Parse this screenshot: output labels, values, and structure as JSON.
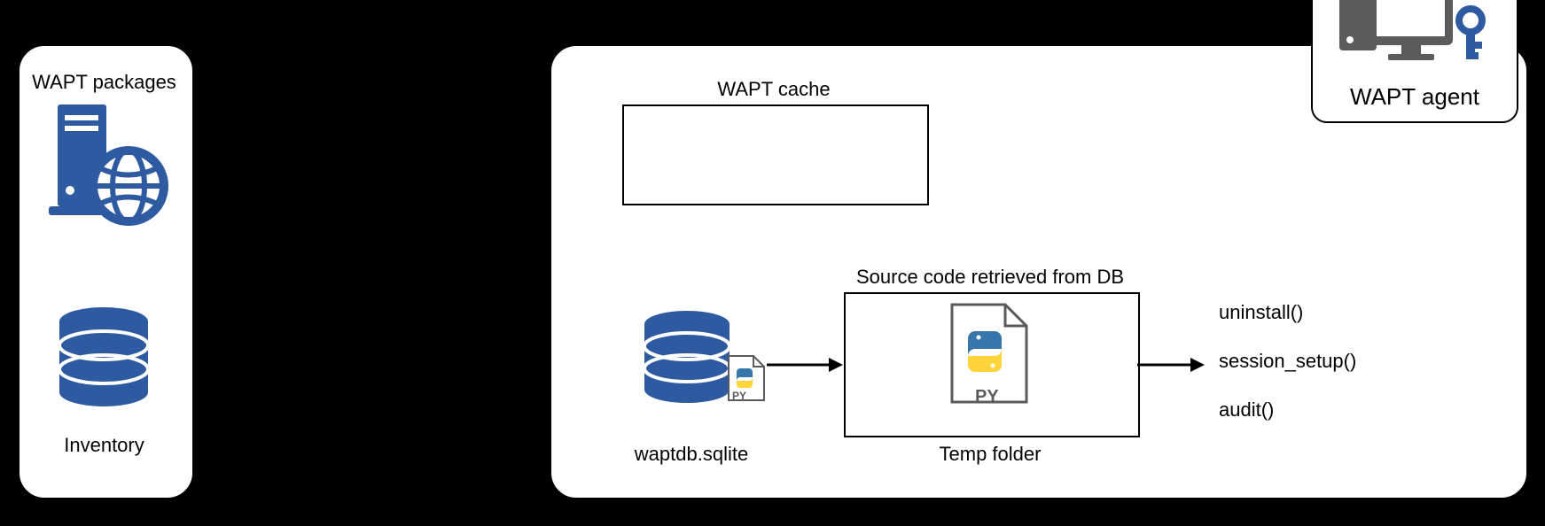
{
  "server": {
    "packages_label": "WAPT packages",
    "inventory_label": "Inventory"
  },
  "agent": {
    "badge_label": "WAPT agent",
    "cache_label": "WAPT cache",
    "db_label": "waptdb.sqlite",
    "source_label": "Source code retrieved from DB",
    "temp_label": "Temp folder",
    "py_small_label": "PY",
    "py_big_label": "PY",
    "functions": {
      "uninstall": "uninstall()",
      "session_setup": "session_setup()",
      "audit": "audit()"
    }
  },
  "colors": {
    "brand": "#2d5aa0",
    "py_blue": "#3776ab",
    "py_yellow": "#ffd43b",
    "grey": "#5b5b5b"
  }
}
